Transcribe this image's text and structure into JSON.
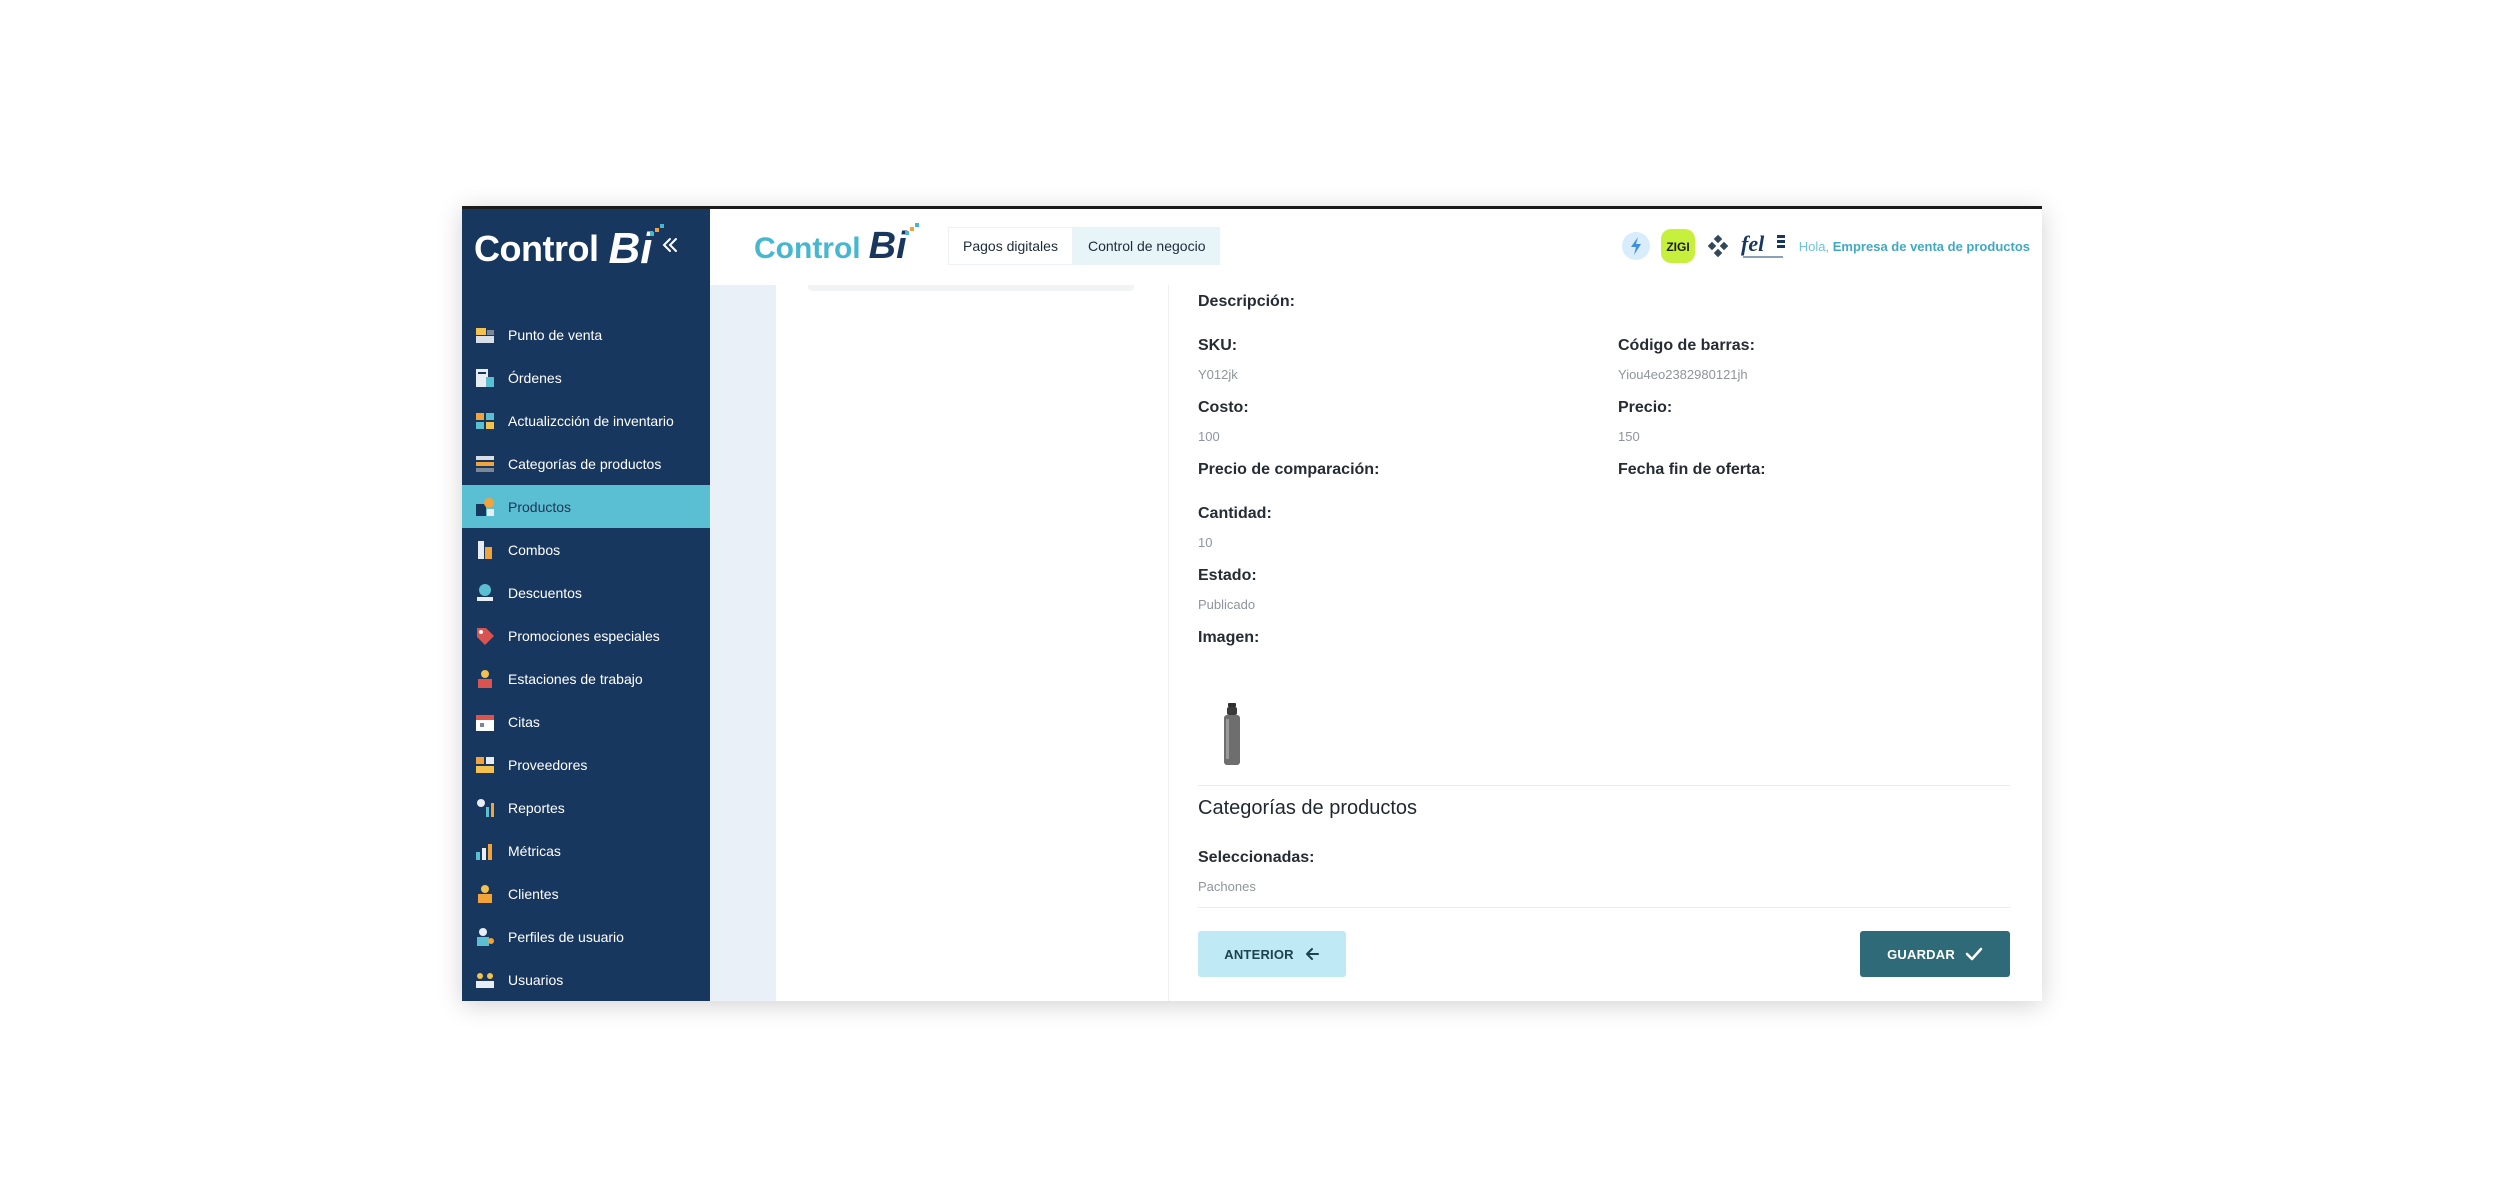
{
  "sidebar": {
    "logo_word": "Control",
    "logo_bi": "Bi",
    "items": [
      {
        "label": "Punto de venta",
        "icon": "cash-register-icon",
        "active": false
      },
      {
        "label": "Órdenes",
        "icon": "orders-icon",
        "active": false
      },
      {
        "label": "Actualizcción de inventario",
        "icon": "inventory-icon",
        "active": false
      },
      {
        "label": "Categorías de productos",
        "icon": "categories-icon",
        "active": false
      },
      {
        "label": "Productos",
        "icon": "products-icon",
        "active": true
      },
      {
        "label": "Combos",
        "icon": "combos-icon",
        "active": false
      },
      {
        "label": "Descuentos",
        "icon": "discount-icon",
        "active": false
      },
      {
        "label": "Promociones especiales",
        "icon": "promotions-icon",
        "active": false
      },
      {
        "label": "Estaciones de trabajo",
        "icon": "workstation-icon",
        "active": false
      },
      {
        "label": "Citas",
        "icon": "calendar-icon",
        "active": false
      },
      {
        "label": "Proveedores",
        "icon": "suppliers-icon",
        "active": false
      },
      {
        "label": "Reportes",
        "icon": "reports-icon",
        "active": false
      },
      {
        "label": "Métricas",
        "icon": "metrics-icon",
        "active": false
      },
      {
        "label": "Clientes",
        "icon": "clients-icon",
        "active": false
      },
      {
        "label": "Perfiles de usuario",
        "icon": "user-profile-icon",
        "active": false
      },
      {
        "label": "Usuarios",
        "icon": "users-icon",
        "active": false
      }
    ]
  },
  "header": {
    "logo_word": "Control",
    "logo_bi": "Bi",
    "tabs": [
      {
        "label": "Pagos digitales",
        "active": false
      },
      {
        "label": "Control de negocio",
        "active": true
      }
    ],
    "badge_zigi": "ZIGI",
    "badge_fel": "fel",
    "greeting": "Hola,",
    "company": "Empresa de venta de productos"
  },
  "product": {
    "description_label": "Descripción:",
    "sku_label": "SKU:",
    "sku_value": "Y012jk",
    "barcode_label": "Código de barras:",
    "barcode_value": "Yiou4eo2382980121jh",
    "cost_label": "Costo:",
    "cost_value": "100",
    "price_label": "Precio:",
    "price_value": "150",
    "compare_label": "Precio de comparación:",
    "offer_end_label": "Fecha fin de oferta:",
    "quantity_label": "Cantidad:",
    "quantity_value": "10",
    "status_label": "Estado:",
    "status_value": "Publicado",
    "image_label": "Imagen:"
  },
  "categories": {
    "title": "Categorías de productos",
    "selected_label": "Seleccionadas:",
    "selected_value": "Pachones"
  },
  "actions": {
    "prev_label": "ANTERIOR",
    "save_label": "GUARDAR"
  },
  "colors": {
    "sidebar_bg": "#18375f",
    "active_item": "#5bbfd3",
    "accent": "#47b7cf",
    "save_button": "#2f6a78",
    "prev_button": "#bfe9f4"
  }
}
